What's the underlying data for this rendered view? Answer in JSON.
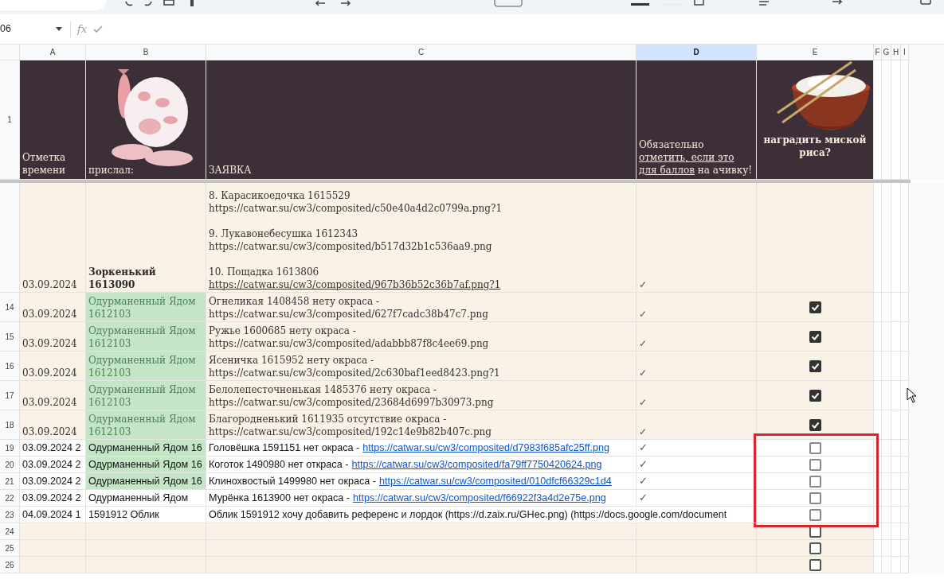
{
  "name_box": "06",
  "formula_label": "fx",
  "columns": [
    {
      "label": "A",
      "selected": false
    },
    {
      "label": "B",
      "selected": false
    },
    {
      "label": "C",
      "selected": false
    },
    {
      "label": "D",
      "selected": true
    },
    {
      "label": "E",
      "selected": false
    },
    {
      "label": "F",
      "selected": false
    },
    {
      "label": "G",
      "selected": false
    },
    {
      "label": "H",
      "selected": false
    },
    {
      "label": "I",
      "selected": false
    }
  ],
  "header_row": {
    "number": "1",
    "time": "Отметка времени",
    "sender": "прислал:",
    "request": "ЗАЯВКА",
    "note": {
      "before": "Обязательно",
      "link": "отметить, если это для баллов",
      "after": "на ачивку!"
    },
    "reward": "наградить миской риса?"
  },
  "rows": [
    {
      "kind": "block",
      "date": "03.09.2024",
      "sender": "Зоркенький 1613090",
      "highlight": false,
      "request": [
        {
          "lines": [
            "8. Карасикоедочка 1615529",
            "https://catwar.su/cw3/composited/c50e40a4d2c0799a.png?1"
          ]
        },
        {
          "lines": [
            "9. Лукавонебесушка 1612343",
            "https://catwar.su/cw3/composited/b517d32b1c536aa9.png"
          ]
        },
        {
          "lines": [
            "10. Пощадка 1613806"
          ],
          "link": "https://catwar.su/cw3/composited/967b36b52c36b7af.png?1"
        }
      ],
      "mark": "✓"
    },
    {
      "kind": "tall",
      "number": "14",
      "date": "03.09.2024",
      "sender": "Одурманенный Ядом 1612103",
      "highlight": true,
      "request": [
        {
          "lines": [
            "Огнеликая 1408458 нету окраса -",
            "https://catwar.su/cw3/composited/627f7cadc38b47c7.png"
          ]
        }
      ],
      "mark": "✓",
      "checked": true
    },
    {
      "kind": "tall",
      "number": "15",
      "date": "03.09.2024",
      "sender": "Одурманенный Ядом 1612103",
      "highlight": true,
      "request": [
        {
          "lines": [
            "Ружье 1600685 нету окраса -",
            "https://catwar.su/cw3/composited/adabbb87f8c4ee69.png"
          ]
        }
      ],
      "mark": "✓",
      "checked": true
    },
    {
      "kind": "tall",
      "number": "16",
      "date": "03.09.2024",
      "sender": "Одурманенный Ядом 1612103",
      "highlight": true,
      "request": [
        {
          "lines": [
            "Ясеничка 1615952 нету окраса -",
            "https://catwar.su/cw3/composited/2c630baf1eed8423.png?1"
          ]
        }
      ],
      "mark": "✓",
      "checked": true
    },
    {
      "kind": "tall",
      "number": "17",
      "date": "03.09.2024",
      "sender": "Одурманенный Ядом 1612103",
      "highlight": true,
      "request": [
        {
          "lines": [
            "Белолепесточненькая 1485376 нету окраса -",
            "https://catwar.su/cw3/composited/23684d6997b30973.png"
          ]
        }
      ],
      "mark": "✓",
      "checked": true
    },
    {
      "kind": "tall",
      "number": "18",
      "date": "03.09.2024",
      "sender": "Одурманенный Ядом 1612103",
      "highlight": true,
      "request": [
        {
          "lines": [
            "Благородненький 1611935 отсутствие окраса -",
            "https://catwar.su/cw3/composited/192c14e9b82b407c.png"
          ]
        }
      ],
      "mark": "✓",
      "checked": true
    },
    {
      "kind": "plain",
      "number": "19",
      "date": "03.09.2024 2",
      "sender": "Одурманенный Ядом 16",
      "highlight": true,
      "request": [
        {
          "lines": [
            "Головёшка 1591151 нет окраса -"
          ],
          "link": "https://catwar.su/cw3/composited/d7983f685afc25ff.png"
        }
      ],
      "mark": "✓",
      "checked": false
    },
    {
      "kind": "plain",
      "number": "20",
      "date": "03.09.2024 2",
      "sender": "Одурманенный Ядом 16",
      "highlight": true,
      "request": [
        {
          "lines": [
            "Коготок 1490980 нет откраса -"
          ],
          "link": "https://catwar.su/cw3/composited/fa79ff7750420624.png"
        }
      ],
      "mark": "✓",
      "checked": false
    },
    {
      "kind": "plain",
      "number": "21",
      "date": "03.09.2024 2",
      "sender": "Одурманенный Ядом 16",
      "highlight": true,
      "request": [
        {
          "lines": [
            "Клинохвостый 1499980 нет окраса -"
          ],
          "link": "https://catwar.su/cw3/composited/010dfcf66329c1d4"
        }
      ],
      "mark": "✓",
      "checked": false
    },
    {
      "kind": "plain",
      "number": "22",
      "date": "03.09.2024 2",
      "sender": "Одурманенный Ядом",
      "highlight": false,
      "request": [
        {
          "lines": [
            "Мурёнка 1613900 нет окраса -"
          ],
          "link": "https://catwar.su/cw3/composited/f66922f3a4d2e75e.png"
        }
      ],
      "mark": "✓",
      "checked": false
    },
    {
      "kind": "plain",
      "number": "23",
      "date": "04.09.2024 1",
      "sender": "1591912 Облик",
      "highlight": false,
      "request": [
        {
          "lines": [
            "Облик 1591912 хочу добавить референс и лордок (https://d.zaix.ru/GHec.png) (https://docs.google.com/document"
          ]
        }
      ],
      "checked": false
    },
    {
      "kind": "empty",
      "number": "24",
      "checked": false
    },
    {
      "kind": "empty",
      "number": "25",
      "checked": false
    },
    {
      "kind": "empty",
      "number": "26",
      "checked": false
    }
  ]
}
